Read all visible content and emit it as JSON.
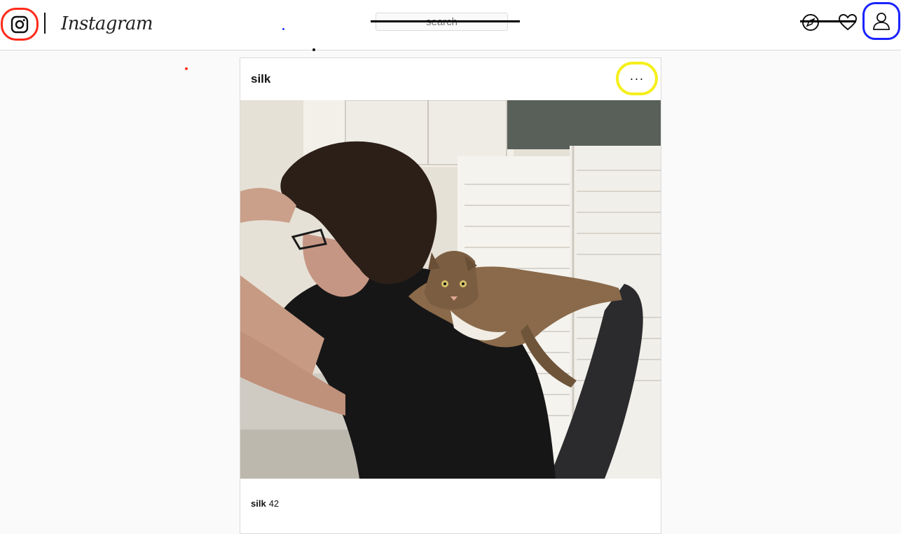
{
  "header": {
    "logo_text": "Instagram",
    "search_placeholder": "search",
    "icons": {
      "app_icon": "instagram-camera-icon",
      "explore": "compass-icon",
      "activity": "heart-icon",
      "profile": "person-icon"
    }
  },
  "post": {
    "username": "silk",
    "more_label": "···",
    "caption_username": "silk",
    "caption_count": "42"
  },
  "colors": {
    "app_icon_ring": "#ff2a1a",
    "profile_ring": "#1a23ff",
    "more_ring": "#f5ef1b"
  }
}
